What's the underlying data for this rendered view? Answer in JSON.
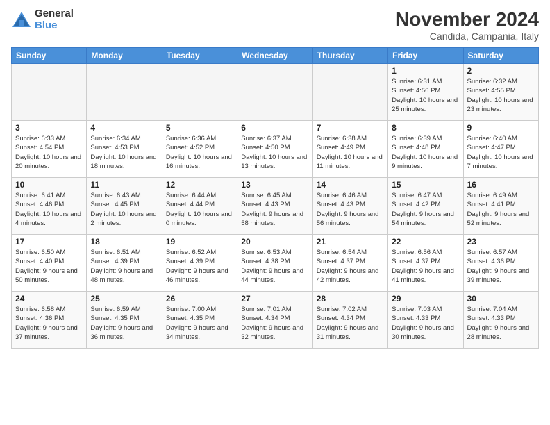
{
  "logo": {
    "general": "General",
    "blue": "Blue"
  },
  "header": {
    "month_year": "November 2024",
    "location": "Candida, Campania, Italy"
  },
  "weekdays": [
    "Sunday",
    "Monday",
    "Tuesday",
    "Wednesday",
    "Thursday",
    "Friday",
    "Saturday"
  ],
  "weeks": [
    [
      {
        "day": "",
        "info": ""
      },
      {
        "day": "",
        "info": ""
      },
      {
        "day": "",
        "info": ""
      },
      {
        "day": "",
        "info": ""
      },
      {
        "day": "",
        "info": ""
      },
      {
        "day": "1",
        "info": "Sunrise: 6:31 AM\nSunset: 4:56 PM\nDaylight: 10 hours and 25 minutes."
      },
      {
        "day": "2",
        "info": "Sunrise: 6:32 AM\nSunset: 4:55 PM\nDaylight: 10 hours and 23 minutes."
      }
    ],
    [
      {
        "day": "3",
        "info": "Sunrise: 6:33 AM\nSunset: 4:54 PM\nDaylight: 10 hours and 20 minutes."
      },
      {
        "day": "4",
        "info": "Sunrise: 6:34 AM\nSunset: 4:53 PM\nDaylight: 10 hours and 18 minutes."
      },
      {
        "day": "5",
        "info": "Sunrise: 6:36 AM\nSunset: 4:52 PM\nDaylight: 10 hours and 16 minutes."
      },
      {
        "day": "6",
        "info": "Sunrise: 6:37 AM\nSunset: 4:50 PM\nDaylight: 10 hours and 13 minutes."
      },
      {
        "day": "7",
        "info": "Sunrise: 6:38 AM\nSunset: 4:49 PM\nDaylight: 10 hours and 11 minutes."
      },
      {
        "day": "8",
        "info": "Sunrise: 6:39 AM\nSunset: 4:48 PM\nDaylight: 10 hours and 9 minutes."
      },
      {
        "day": "9",
        "info": "Sunrise: 6:40 AM\nSunset: 4:47 PM\nDaylight: 10 hours and 7 minutes."
      }
    ],
    [
      {
        "day": "10",
        "info": "Sunrise: 6:41 AM\nSunset: 4:46 PM\nDaylight: 10 hours and 4 minutes."
      },
      {
        "day": "11",
        "info": "Sunrise: 6:43 AM\nSunset: 4:45 PM\nDaylight: 10 hours and 2 minutes."
      },
      {
        "day": "12",
        "info": "Sunrise: 6:44 AM\nSunset: 4:44 PM\nDaylight: 10 hours and 0 minutes."
      },
      {
        "day": "13",
        "info": "Sunrise: 6:45 AM\nSunset: 4:43 PM\nDaylight: 9 hours and 58 minutes."
      },
      {
        "day": "14",
        "info": "Sunrise: 6:46 AM\nSunset: 4:43 PM\nDaylight: 9 hours and 56 minutes."
      },
      {
        "day": "15",
        "info": "Sunrise: 6:47 AM\nSunset: 4:42 PM\nDaylight: 9 hours and 54 minutes."
      },
      {
        "day": "16",
        "info": "Sunrise: 6:49 AM\nSunset: 4:41 PM\nDaylight: 9 hours and 52 minutes."
      }
    ],
    [
      {
        "day": "17",
        "info": "Sunrise: 6:50 AM\nSunset: 4:40 PM\nDaylight: 9 hours and 50 minutes."
      },
      {
        "day": "18",
        "info": "Sunrise: 6:51 AM\nSunset: 4:39 PM\nDaylight: 9 hours and 48 minutes."
      },
      {
        "day": "19",
        "info": "Sunrise: 6:52 AM\nSunset: 4:39 PM\nDaylight: 9 hours and 46 minutes."
      },
      {
        "day": "20",
        "info": "Sunrise: 6:53 AM\nSunset: 4:38 PM\nDaylight: 9 hours and 44 minutes."
      },
      {
        "day": "21",
        "info": "Sunrise: 6:54 AM\nSunset: 4:37 PM\nDaylight: 9 hours and 42 minutes."
      },
      {
        "day": "22",
        "info": "Sunrise: 6:56 AM\nSunset: 4:37 PM\nDaylight: 9 hours and 41 minutes."
      },
      {
        "day": "23",
        "info": "Sunrise: 6:57 AM\nSunset: 4:36 PM\nDaylight: 9 hours and 39 minutes."
      }
    ],
    [
      {
        "day": "24",
        "info": "Sunrise: 6:58 AM\nSunset: 4:36 PM\nDaylight: 9 hours and 37 minutes."
      },
      {
        "day": "25",
        "info": "Sunrise: 6:59 AM\nSunset: 4:35 PM\nDaylight: 9 hours and 36 minutes."
      },
      {
        "day": "26",
        "info": "Sunrise: 7:00 AM\nSunset: 4:35 PM\nDaylight: 9 hours and 34 minutes."
      },
      {
        "day": "27",
        "info": "Sunrise: 7:01 AM\nSunset: 4:34 PM\nDaylight: 9 hours and 32 minutes."
      },
      {
        "day": "28",
        "info": "Sunrise: 7:02 AM\nSunset: 4:34 PM\nDaylight: 9 hours and 31 minutes."
      },
      {
        "day": "29",
        "info": "Sunrise: 7:03 AM\nSunset: 4:33 PM\nDaylight: 9 hours and 30 minutes."
      },
      {
        "day": "30",
        "info": "Sunrise: 7:04 AM\nSunset: 4:33 PM\nDaylight: 9 hours and 28 minutes."
      }
    ]
  ]
}
